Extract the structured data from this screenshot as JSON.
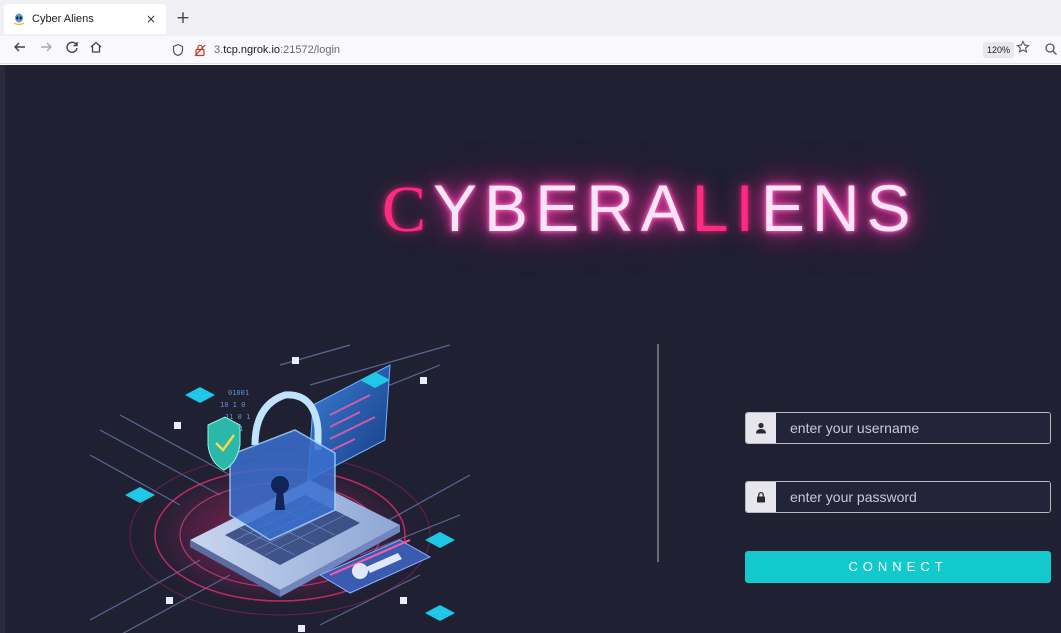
{
  "browser": {
    "tab_title": "Cyber Aliens",
    "tab_close": "×",
    "new_tab": "+",
    "url_host_pre": "3.",
    "url_host": "tcp.ngrok.io",
    "url_rest": ":21572/login",
    "zoom": "120%",
    "icons": {
      "back": "arrow-left-icon",
      "forward": "arrow-right-icon",
      "reload": "reload-icon",
      "home": "home-icon",
      "shield": "tracking-shield-icon",
      "lock": "insecure-lock-icon",
      "star": "bookmark-star-icon",
      "search": "search-icon"
    }
  },
  "page": {
    "title_first": "C",
    "title_mid1": "YBERA",
    "title_li": "LI",
    "title_mid2": "ENS",
    "colors": {
      "background": "#1f2032",
      "neon_pink": "#ff2a82",
      "neon_glow": "#ff40b4",
      "accent": "#12c9cc"
    }
  },
  "login": {
    "username_placeholder": "enter your username",
    "password_placeholder": "enter your password",
    "connect_label": "CONNECT",
    "username_icon": "user-icon",
    "password_icon": "lock-icon"
  }
}
